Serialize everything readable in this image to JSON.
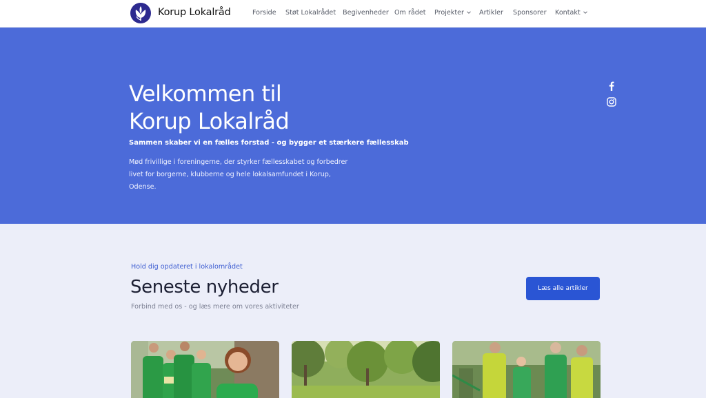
{
  "header": {
    "brand": "Korup Lokalråd",
    "logo_icon": "tulip-logo-icon",
    "nav": [
      {
        "label": "Forside"
      },
      {
        "label": "Støt Lokalrådet"
      },
      {
        "label": "Begivenheder"
      },
      {
        "label": "Om rådet"
      },
      {
        "label": "Projekter",
        "dropdown": true
      },
      {
        "label": "Artikler"
      },
      {
        "label": "Sponsorer"
      },
      {
        "label": "Kontakt",
        "dropdown": true
      }
    ]
  },
  "hero": {
    "title_line1": "Velkommen til",
    "title_line2": "Korup Lokalråd",
    "subtitle": "Sammen skaber vi en fælles forstad - og bygger et stærkere fællesskab",
    "body": "Mød frivillige i foreningerne, der styrker fællesskabet og forbedrer livet for borgerne, klubberne og hele lokalsamfundet i Korup, Odense.",
    "social": [
      "facebook-icon",
      "instagram-icon"
    ]
  },
  "news": {
    "eyebrow": "Hold dig opdateret i lokalområdet",
    "title": "Seneste nyheder",
    "subtitle": "Forbind med os - og læs mere om vores aktiviteter",
    "button": "Læs alle artikler"
  },
  "colors": {
    "hero_bg": "#4c6bd9",
    "section_bg": "#eceef9",
    "button": "#2a55d4",
    "logo": "#2d2a8f"
  }
}
